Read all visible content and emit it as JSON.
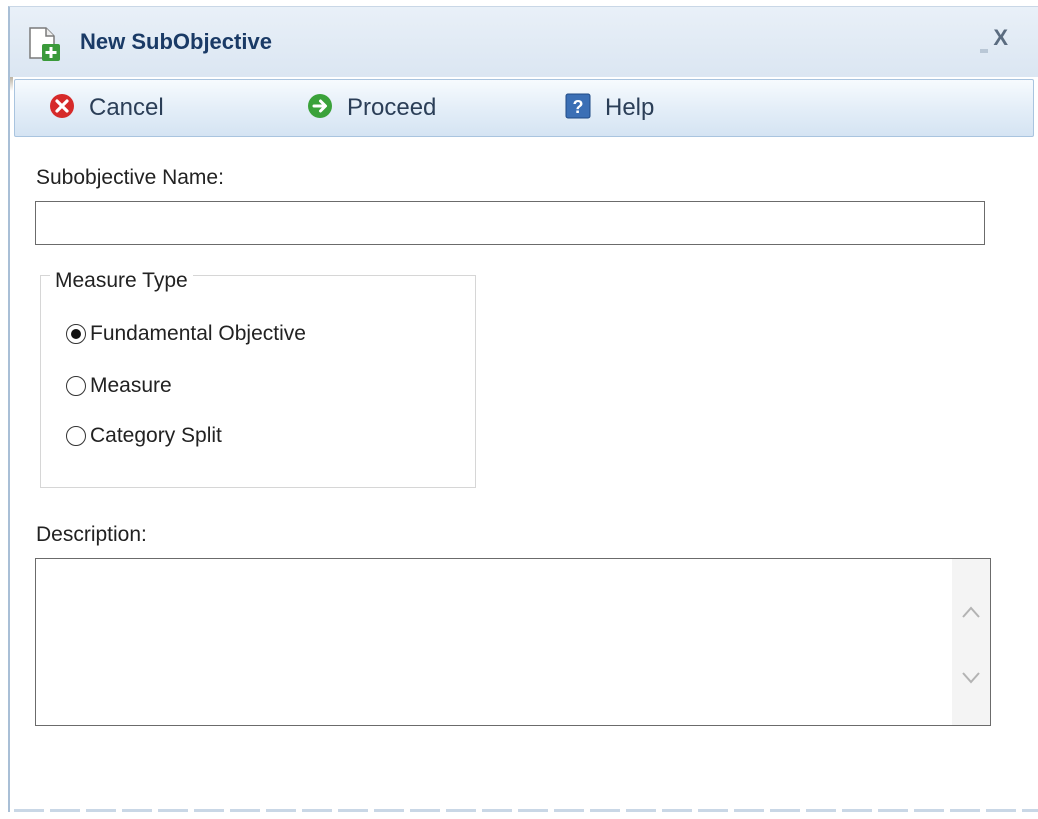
{
  "dialog": {
    "title": "New SubObjective",
    "close_label": "X",
    "title_icon": "new-document-icon"
  },
  "toolbar": {
    "cancel_label": "Cancel",
    "cancel_icon": "cancel-icon",
    "proceed_label": "Proceed",
    "proceed_icon": "proceed-arrow-icon",
    "help_label": "Help",
    "help_icon": "help-icon"
  },
  "form": {
    "name_label": "Subobjective Name:",
    "name_value": "",
    "measure_type_legend": "Measure Type",
    "measure_options": [
      {
        "label": "Fundamental Objective",
        "selected": true
      },
      {
        "label": "Measure",
        "selected": false
      },
      {
        "label": "Category Split",
        "selected": false
      }
    ],
    "description_label": "Description:",
    "description_value": ""
  },
  "colors": {
    "title_text": "#1a3a66",
    "cancel_icon": "#d62a2a",
    "proceed_icon": "#3aa23a",
    "help_icon": "#3b6fb5"
  }
}
